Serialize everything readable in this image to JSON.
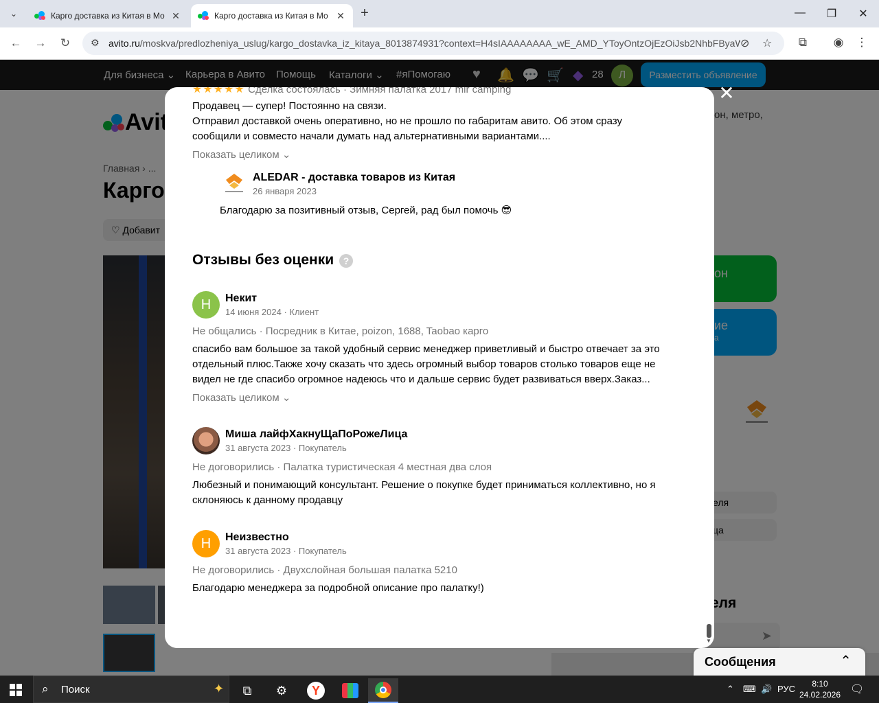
{
  "browser": {
    "tabs": [
      {
        "title": "Карго доставка из Китая в Мо",
        "active": false
      },
      {
        "title": "Карго доставка из Китая в Мо",
        "active": true
      }
    ],
    "url_domain": "avito.ru",
    "url_path": "/moskva/predlozheniya_uslug/kargo_dostavka_iz_kitaya_8013874931?context=H4sIAAAAAAAA_wE_AMD_YToyOntzOjEzOiJsb2NhbFByaW..."
  },
  "site_nav": {
    "items": [
      "Для бизнеса ⌄",
      "Карьера в Авито",
      "Помощь",
      "Каталоги ⌄",
      "#яПомогаю"
    ],
    "count": "28",
    "avatar_letter": "Л",
    "post_button": "Разместить объявление"
  },
  "background": {
    "logo_text": "Avito",
    "search_hint": "он, метро,",
    "breadcrumb": "Главная › ...",
    "title_fragment": "Карго",
    "fav_button": "Добавит",
    "green_button": "он",
    "blue_button": "ие",
    "blue_button_sub": "а",
    "pill_1": "еля",
    "pill_2": "ца",
    "side_title": "еля"
  },
  "modal": {
    "top_review": {
      "meta": "Сделка состоялась · Зимняя палатка 2017 mir camping",
      "text_line1": "Продавец — супер! Постоянно на связи.",
      "text_line2": "Отправил доставкой очень оперативно, но не прошло по габаритам авито. Об этом сразу",
      "text_line3": "сообщили и совместо начали думать над альтернативными вариантами....",
      "show_more": "Показать целиком ⌄"
    },
    "seller_reply": {
      "name": "ALEDAR - доставка товаров из Китая",
      "date": "26 января 2023",
      "text": "Благодарю за позитивный отзыв, Сергей, рад был помочь 😎"
    },
    "section_title": "Отзывы без оценки",
    "reviews": [
      {
        "initial": "Н",
        "name": "Некит",
        "meta": "14 июня 2024 · Клиент",
        "deal": "Не общались · Посредник в Китае, poizon, 1688, Taobao карго",
        "line1": "спасибо вам большое за такой удобный сервис менеджер приветливый и быстро отвечает за это",
        "line2": "отдельный плюс.Также хочу сказать что здесь огромный выбор товаров столько товаров еще не",
        "line3": "видел не где спасибо огромное надеюсь что и дальше сервис будет развиваться вверх.Заказ...",
        "show_more": "Показать целиком ⌄"
      },
      {
        "initial": "",
        "name": "Миша лайфХакнуЩаПоРожеЛица",
        "meta": "31 августа 2023 · Покупатель",
        "deal": "Не договорились · Палатка туристическая 4 местная два слоя",
        "line1": "Любезный и понимающий консультант. Решение о покупке будет приниматься коллективно, но я",
        "line2": "склоняюсь к данному продавцу"
      },
      {
        "initial": "Н",
        "name": "Неизвестно",
        "meta": "31 августа 2023 · Покупатель",
        "deal": "Не договорились · Двухслойная большая палатка 5210",
        "line1": "Благодарю менеджера за подробной описание про палатку!)"
      }
    ]
  },
  "messages_widget": {
    "label": "Сообщения"
  },
  "taskbar": {
    "search_text": "Поиск",
    "lang": "РУС",
    "time": "8:10",
    "date": "24.02.2026"
  },
  "colors": {
    "avito_blue": "#00aaff",
    "avito_green": "#04c139",
    "avatar_green": "#8bc34a",
    "avatar_orange": "#ff9f00",
    "star": "#ffb021"
  }
}
